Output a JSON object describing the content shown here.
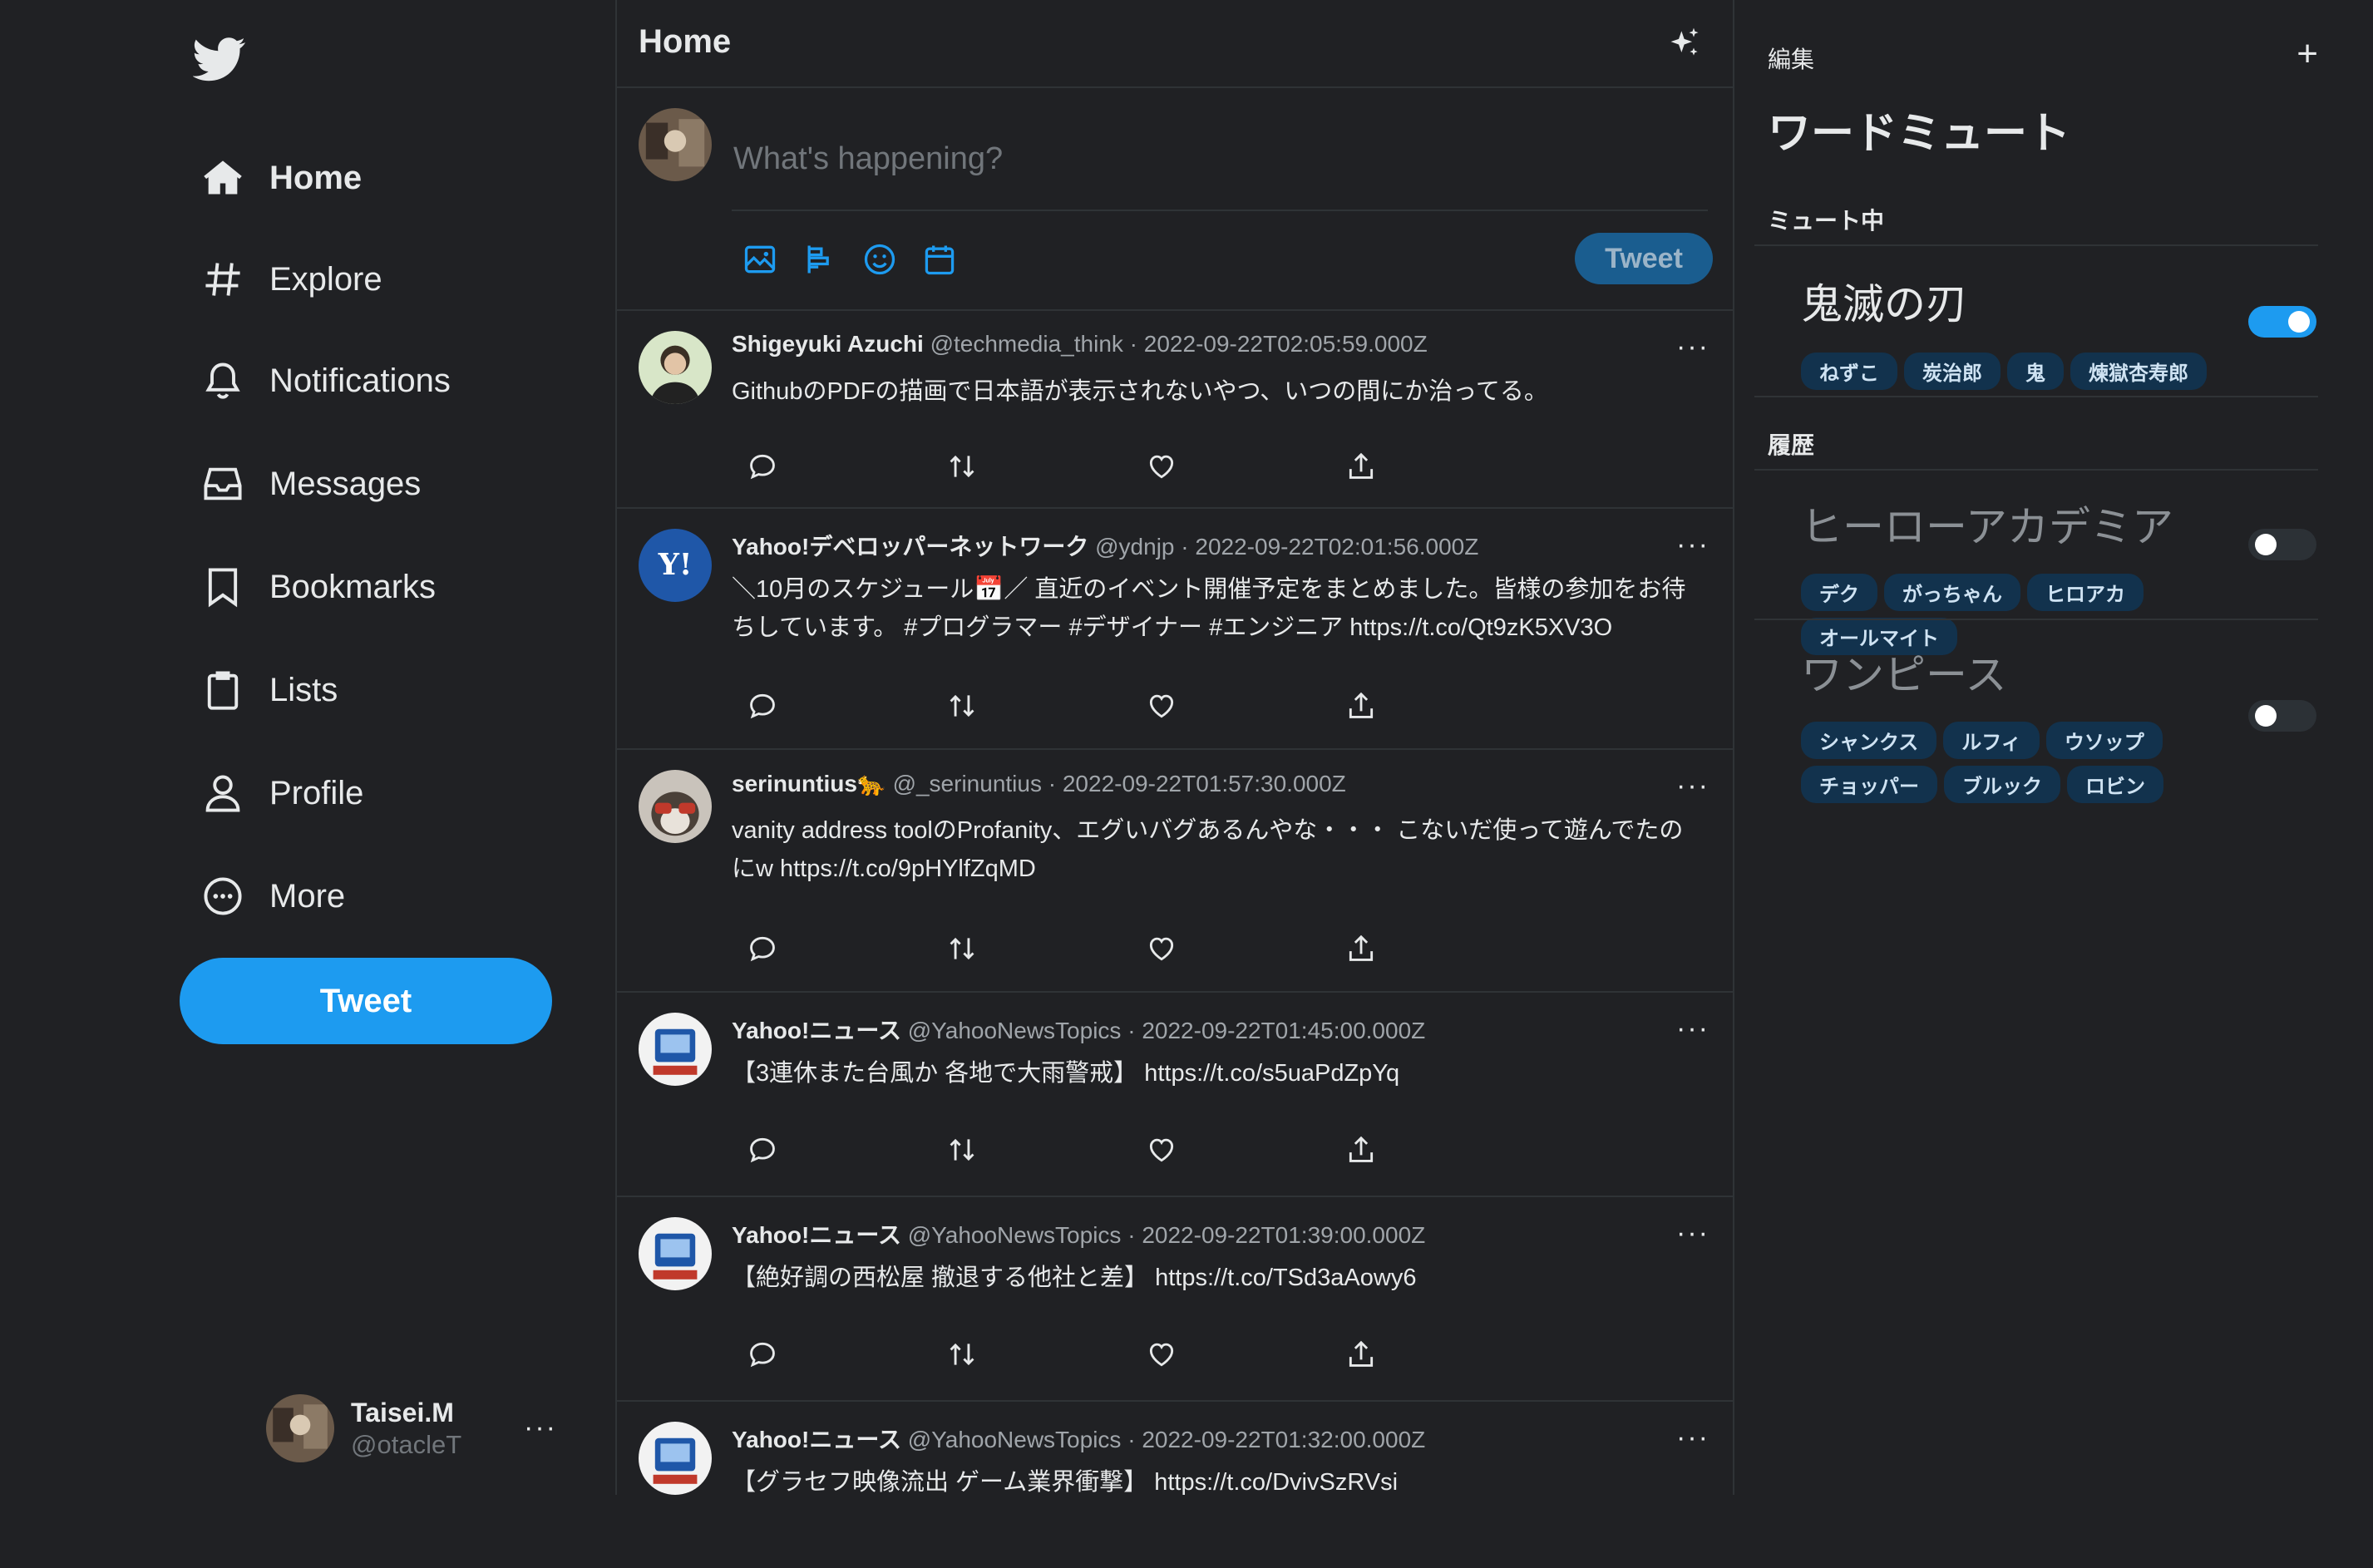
{
  "nav": {
    "items": [
      {
        "label": "Home",
        "icon": "home-icon"
      },
      {
        "label": "Explore",
        "icon": "hashtag-icon"
      },
      {
        "label": "Notifications",
        "icon": "bell-icon"
      },
      {
        "label": "Messages",
        "icon": "inbox-icon"
      },
      {
        "label": "Bookmarks",
        "icon": "bookmark-icon"
      },
      {
        "label": "Lists",
        "icon": "list-icon"
      },
      {
        "label": "Profile",
        "icon": "person-icon"
      },
      {
        "label": "More",
        "icon": "more-circle-icon"
      }
    ],
    "tweet_button": "Tweet"
  },
  "account": {
    "name": "Taisei.M",
    "handle": "@otacleT"
  },
  "header": {
    "title": "Home"
  },
  "compose": {
    "placeholder": "What's happening?",
    "tweet_button": "Tweet"
  },
  "tweets": [
    {
      "name": "Shigeyuki Azuchi",
      "handle": "@techmedia_think",
      "time": "2022-09-22T02:05:59.000Z",
      "text": "GithubのPDFの描画で日本語が表示されないやつ、いつの間にか治ってる。"
    },
    {
      "name": "Yahoo!デベロッパーネットワーク",
      "handle": "@ydnjp",
      "time": "2022-09-22T02:01:56.000Z",
      "text": "＼10月のスケジュール📅／ 直近のイベント開催予定をまとめました。皆様の参加をお待ちしています。 #プログラマー #デザイナー #エンジニア https://t.co/Qt9zK5XV3O"
    },
    {
      "name": "serinuntius🐆",
      "handle": "@_serinuntius",
      "time": "2022-09-22T01:57:30.000Z",
      "text": "vanity address toolのProfanity、エグいバグあるんやな・・・ こないだ使って遊んでたのにw https://t.co/9pHYlfZqMD"
    },
    {
      "name": "Yahoo!ニュース",
      "handle": "@YahooNewsTopics",
      "time": "2022-09-22T01:45:00.000Z",
      "text": "【3連休また台風か 各地で大雨警戒】 https://t.co/s5uaPdZpYq"
    },
    {
      "name": "Yahoo!ニュース",
      "handle": "@YahooNewsTopics",
      "time": "2022-09-22T01:39:00.000Z",
      "text": "【絶好調の西松屋 撤退する他社と差】 https://t.co/TSd3aAowy6"
    },
    {
      "name": "Yahoo!ニュース",
      "handle": "@YahooNewsTopics",
      "time": "2022-09-22T01:32:00.000Z",
      "text": "【グラセフ映像流出 ゲーム業界衝撃】 https://t.co/DvivSzRVsi"
    }
  ],
  "mute": {
    "edit_label": "編集",
    "title": "ワードミュート",
    "active_section": "ミュート中",
    "history_section": "履歴",
    "active": [
      {
        "word": "鬼滅の刃",
        "tags": [
          "ねずこ",
          "炭治郎",
          "鬼",
          "煉獄杏寿郎"
        ],
        "enabled": true
      }
    ],
    "history": [
      {
        "word": "ヒーローアカデミア",
        "tags": [
          "デク",
          "がっちゃん",
          "ヒロアカ",
          "オールマイト"
        ],
        "enabled": false
      },
      {
        "word": "ワンピース",
        "tags": [
          "シャンクス",
          "ルフィ",
          "ウソップ",
          "チョッパー",
          "ブルック",
          "ロビン"
        ],
        "enabled": false
      }
    ]
  },
  "colors": {
    "accent": "#1d9bf0",
    "background": "#202124",
    "border": "#2f3336"
  }
}
